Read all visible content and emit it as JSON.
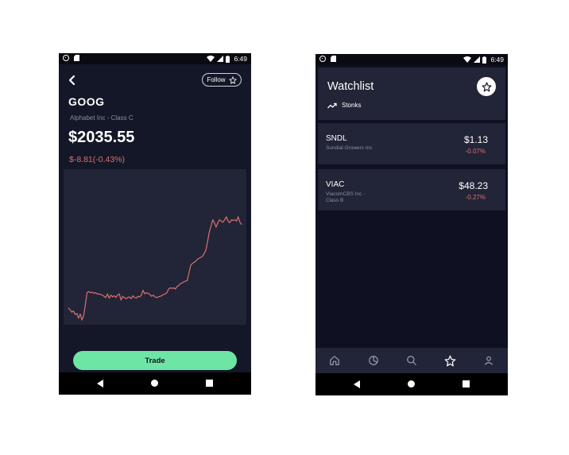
{
  "left_screen": {
    "status": {
      "time": "6:49"
    },
    "follow_label": "Follow",
    "ticker": "GOOG",
    "company": "Alphabet Inc - Class C",
    "price": "$2035.55",
    "change": "$-8.81(-0.43%)",
    "trade_label": "Trade",
    "chart_color": "#d9716d",
    "chart_data": {
      "type": "line",
      "values": [
        55,
        52,
        48,
        50,
        44,
        46,
        38,
        45,
        35,
        42,
        60,
        80,
        82,
        80,
        81,
        79,
        80,
        78,
        78,
        77,
        76,
        74,
        72,
        78,
        71,
        76,
        73,
        75,
        72,
        76,
        78,
        68,
        74,
        72,
        70,
        72,
        73,
        70,
        75,
        72,
        71,
        74,
        73,
        76,
        84,
        78,
        80,
        79,
        77,
        74,
        76,
        73,
        72,
        73,
        74,
        75,
        77,
        78,
        80,
        86,
        88,
        87,
        88,
        86,
        90,
        92,
        95,
        96,
        98,
        99,
        100,
        112,
        125,
        128,
        130,
        132,
        135,
        137,
        138,
        140,
        145,
        150,
        165,
        180,
        190,
        200,
        195,
        188,
        195,
        200,
        198,
        196,
        200,
        205,
        198,
        195,
        200,
        199,
        200,
        198,
        205,
        196,
        192
      ],
      "color": "#d9716d"
    }
  },
  "right_screen": {
    "status": {
      "time": "6:49"
    },
    "title": "Watchlist",
    "subtitle": "Stonks",
    "rows": [
      {
        "symbol": "SNDL",
        "name": "Sundial Growers Inc",
        "price": "$1.13",
        "change": "-0.07%"
      },
      {
        "symbol": "VIAC",
        "name": "ViacomCBS Inc - Class B",
        "price": "$48.23",
        "change": "-0.27%"
      }
    ],
    "tabs": [
      "home-icon",
      "pie-chart-icon",
      "search-icon",
      "star-icon",
      "profile-icon"
    ],
    "active_tab": "star-icon"
  }
}
